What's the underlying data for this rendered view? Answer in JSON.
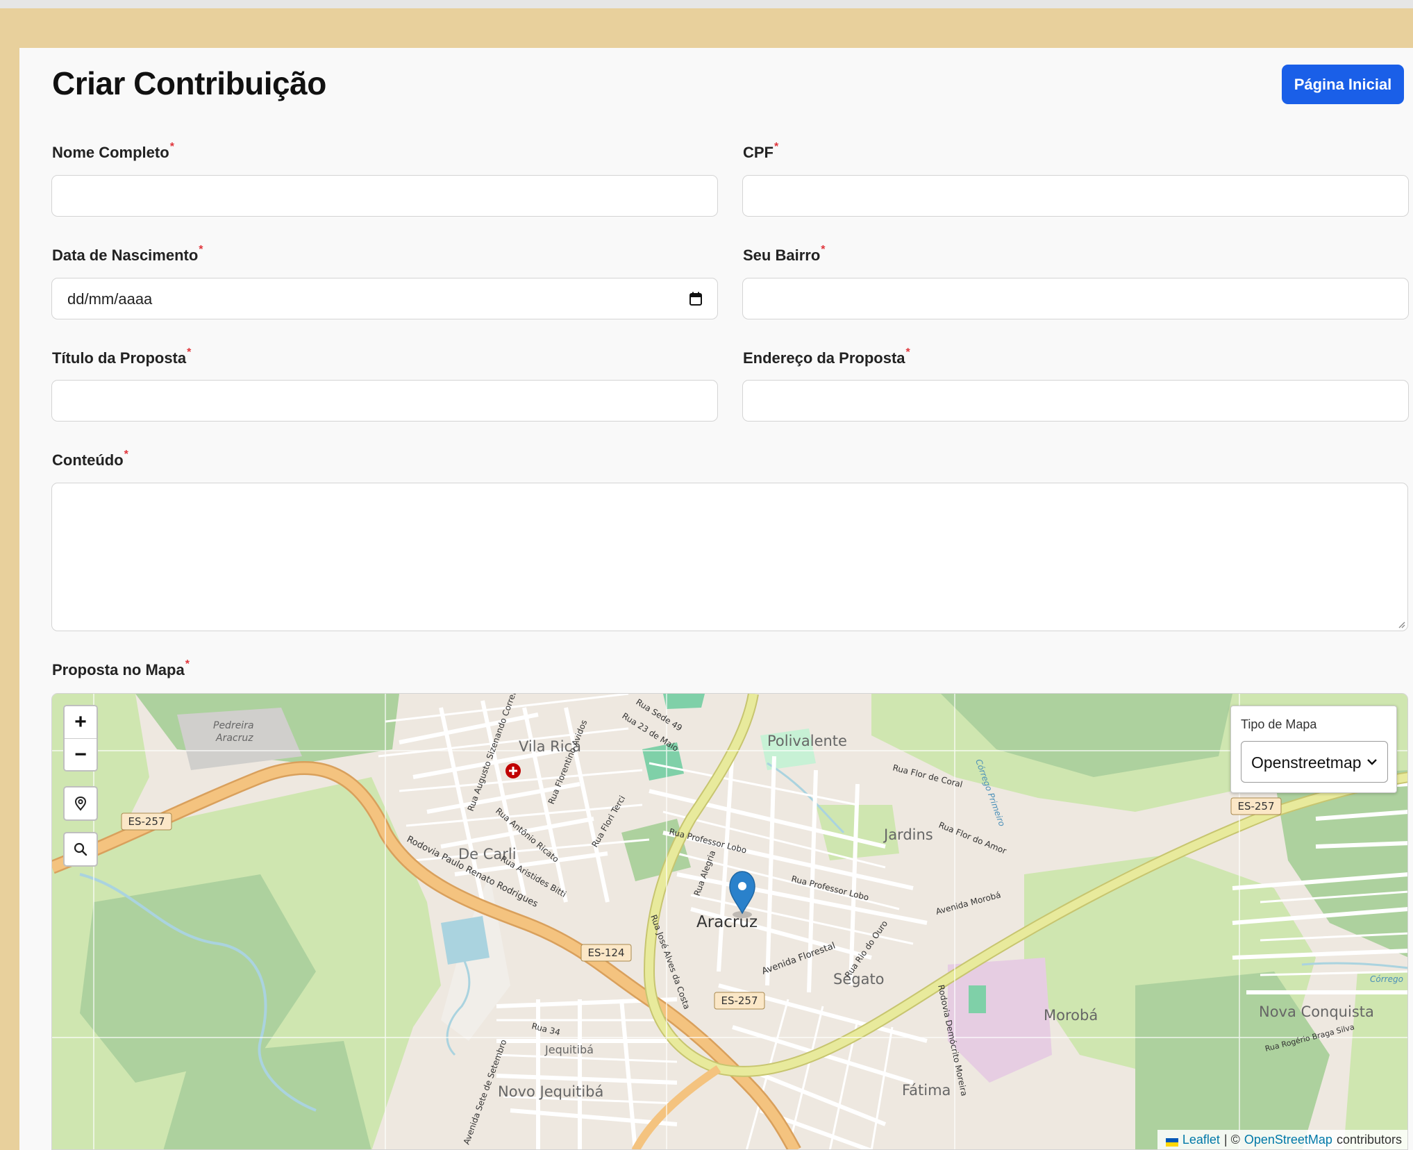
{
  "header": {
    "title": "Criar Contribuição",
    "home_button": "Página Inicial"
  },
  "form": {
    "required_mark": "*",
    "full_name": {
      "label": "Nome Completo",
      "value": ""
    },
    "cpf": {
      "label": "CPF",
      "value": ""
    },
    "birth_date": {
      "label": "Data de Nascimento",
      "placeholder": "dd/mm/aaaa"
    },
    "neighborhood": {
      "label": "Seu Bairro",
      "value": ""
    },
    "proposal_title": {
      "label": "Título da Proposta",
      "value": ""
    },
    "proposal_address": {
      "label": "Endereço da Proposta",
      "value": ""
    },
    "content": {
      "label": "Conteúdo",
      "value": ""
    },
    "map_section": {
      "label": "Proposta no Mapa"
    }
  },
  "map": {
    "controls": {
      "zoom_in": "+",
      "zoom_out": "−",
      "locate_icon": "location-pin-icon",
      "search_icon": "search-icon"
    },
    "map_type": {
      "label": "Tipo de Mapa",
      "selected": "Openstreetmap"
    },
    "attribution": {
      "leaflet": "Leaflet",
      "separator": "| ©",
      "osm": "OpenStreetMap",
      "suffix": "contributors"
    },
    "place_labels": [
      "Pedreira",
      "Aracruz",
      "Vila Rica",
      "Polivalente",
      "De Carli",
      "Jardins",
      "Aracruz",
      "Segato",
      "Morobá",
      "Nova Conquista",
      "Jequitibá",
      "Novo Jequitibá",
      "Fátima"
    ],
    "road_shields": [
      "ES-257",
      "ES-124",
      "ES-257",
      "ES-257"
    ],
    "street_labels": [
      "Rodovia Paulo Renato Rodrigues",
      "Avenida Florestal",
      "Avenida Morobá",
      "Rua Professor Lobo",
      "Rua Professor Lobo",
      "Rua Flor de Coral",
      "Rua Flor do Amor",
      "Rodovia Demócrito Moreira",
      "Rua Rio do Ouro",
      "Rua 34",
      "Avenida Sete de Setembro",
      "Rua 23 de Maio",
      "Rua Sede 49",
      "Rua Aristides Bitti",
      "Rua Antônio Ricato",
      "Rua Augusto Sizenando Correia",
      "Rua Florentino Avidos",
      "Rua Flori Terci",
      "Rua Alegria",
      "Rua José Alves da Costa",
      "Rua Rogério Braga Silva",
      "Córrego Primeiro",
      "Córrego"
    ],
    "colors": {
      "primary_road": "#f4c37f",
      "trunk_road": "#e8ea9c",
      "vegetation": "#cfe6b0",
      "forest": "#add19e",
      "urban": "#eee8e0",
      "water": "#aad3df",
      "marker": "#2a81cb"
    }
  },
  "colors": {
    "page_bg": "#e8d09c",
    "card_bg": "#f9f9f9",
    "accent": "#1a5fe8",
    "required": "#e0353b"
  }
}
